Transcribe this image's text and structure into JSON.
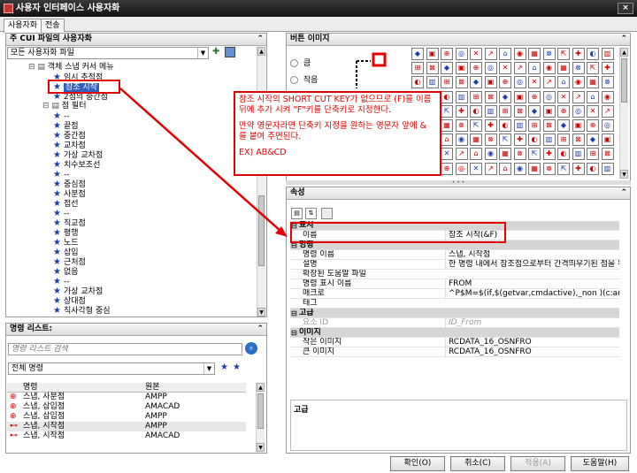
{
  "window": {
    "title": "사용자 인터페이스 사용자화",
    "close": "×"
  },
  "tabs": [
    {
      "label": "사용자화"
    },
    {
      "label": "전송"
    }
  ],
  "left_top": {
    "header": "주 CUI 파일의 사용자화",
    "file_combo": "모든 사용자화 파일",
    "tree": [
      "객체 스냅 커서 메뉴",
      "임시 추적점",
      "참조 시작",
      "2점의 중간점",
      "점 필터",
      "--",
      "끝점",
      "중간점",
      "교차점",
      "가상 교차점",
      "치수보조선",
      "--",
      "중심점",
      "사분점",
      "접선",
      "--",
      "직교점",
      "평행",
      "노드",
      "삽입",
      "근처점",
      "없음",
      "--",
      "가상 교차점",
      "상대점",
      "직사각형 중심"
    ]
  },
  "command_list": {
    "header": "명령 리스트:",
    "search_placeholder": "명령 리스트 검색",
    "filter_combo": "전체 명령",
    "columns": [
      "명령",
      "원본"
    ],
    "rows": [
      {
        "name": "스냅, 사분점",
        "source": "AMPP"
      },
      {
        "name": "스냅, 삽입점",
        "source": "AMACAD"
      },
      {
        "name": "스냅, 삽입점",
        "source": "AMPP"
      },
      {
        "name": "스냅, 시작점",
        "source": "AMPP"
      },
      {
        "name": "스냅, 시작점",
        "source": "AMACAD"
      }
    ]
  },
  "button_image": {
    "header": "버튼 이미지",
    "options": [
      "큼",
      "작음"
    ]
  },
  "properties": {
    "header": "속성",
    "categories": [
      {
        "name": "표시",
        "rows": [
          {
            "key": "이름",
            "value": "참조 시작(&F)"
          }
        ]
      },
      {
        "name": "명령",
        "rows": [
          {
            "key": "명령 이름",
            "value": "스냅, 시작점"
          },
          {
            "key": "설명",
            "value": "한 명령 내에서 참조점으로부터 간격띄우기된 점을 위치..."
          },
          {
            "key": "확장된 도움말 파일",
            "value": ""
          },
          {
            "key": "명령 표시 이름",
            "value": "FROM"
          },
          {
            "key": "매크로",
            "value": "^P$M=$(if,$(getvar,cmdactive),_non )(c:ampsnapre"
          },
          {
            "key": "태그",
            "value": ""
          }
        ]
      },
      {
        "name": "고급",
        "rows": [
          {
            "key": "요소 ID",
            "value": "ID_From",
            "disabled": true
          }
        ]
      },
      {
        "name": "이미지",
        "rows": [
          {
            "key": "작은 이미지",
            "value": "RCDATA_16_OSNFRO"
          },
          {
            "key": "큰 이미지",
            "value": "RCDATA_16_OSNFRO"
          }
        ]
      }
    ],
    "description_title": "고급"
  },
  "annotation": {
    "line1": "참조 시작의 SHORT CUT KEY가 없으므로 (F)를 이름 뒤에 추가 시켜 \"F\"키를 단축키로 지정한다.",
    "line2": "만약 영문자라면 단축키 지정을 원하는 영문자 앞에 & 를 붙여 주면된다.",
    "line3": "EX) AB&CD"
  },
  "buttons": {
    "ok": "확인(O)",
    "cancel": "취소(C)",
    "apply": "적용(A)",
    "help": "도움말(H)"
  },
  "colors": {
    "accent_red": "#e30000",
    "star_blue": "#1a3fa8"
  }
}
